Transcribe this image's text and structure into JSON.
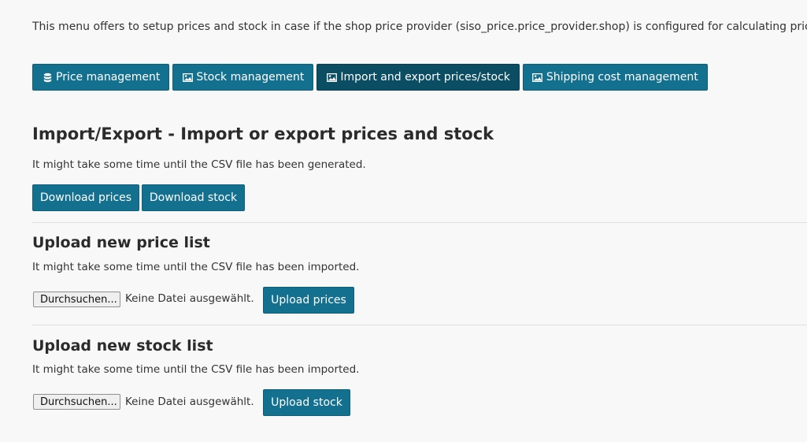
{
  "intro_text": "This menu offers to setup prices and stock in case if the shop price provider (siso_price.price_provider.shop) is configured for calculating prices.",
  "tabs": [
    {
      "label": "Price management",
      "icon": "database-icon",
      "active": false
    },
    {
      "label": "Stock management",
      "icon": "image-icon",
      "active": false
    },
    {
      "label": "Import and export prices/stock",
      "icon": "image-icon",
      "active": true
    },
    {
      "label": "Shipping cost management",
      "icon": "image-icon",
      "active": false
    }
  ],
  "import_export": {
    "title": "Import/Export - Import or export prices and stock",
    "note": "It might take some time until the CSV file has been generated.",
    "download_prices_label": "Download prices",
    "download_stock_label": "Download stock"
  },
  "price_upload": {
    "title": "Upload new price list",
    "note": "It might take some time until the CSV file has been imported.",
    "browse_label": "Durchsuchen...",
    "file_status": "Keine Datei ausgewählt.",
    "upload_label": "Upload prices"
  },
  "stock_upload": {
    "title": "Upload new stock list",
    "note": "It might take some time until the CSV file has been imported.",
    "browse_label": "Durchsuchen...",
    "file_status": "Keine Datei ausgewählt.",
    "upload_label": "Upload stock"
  },
  "colors": {
    "button": "#14708f",
    "button_active": "#0b4d63",
    "background": "#f8f8f8"
  }
}
